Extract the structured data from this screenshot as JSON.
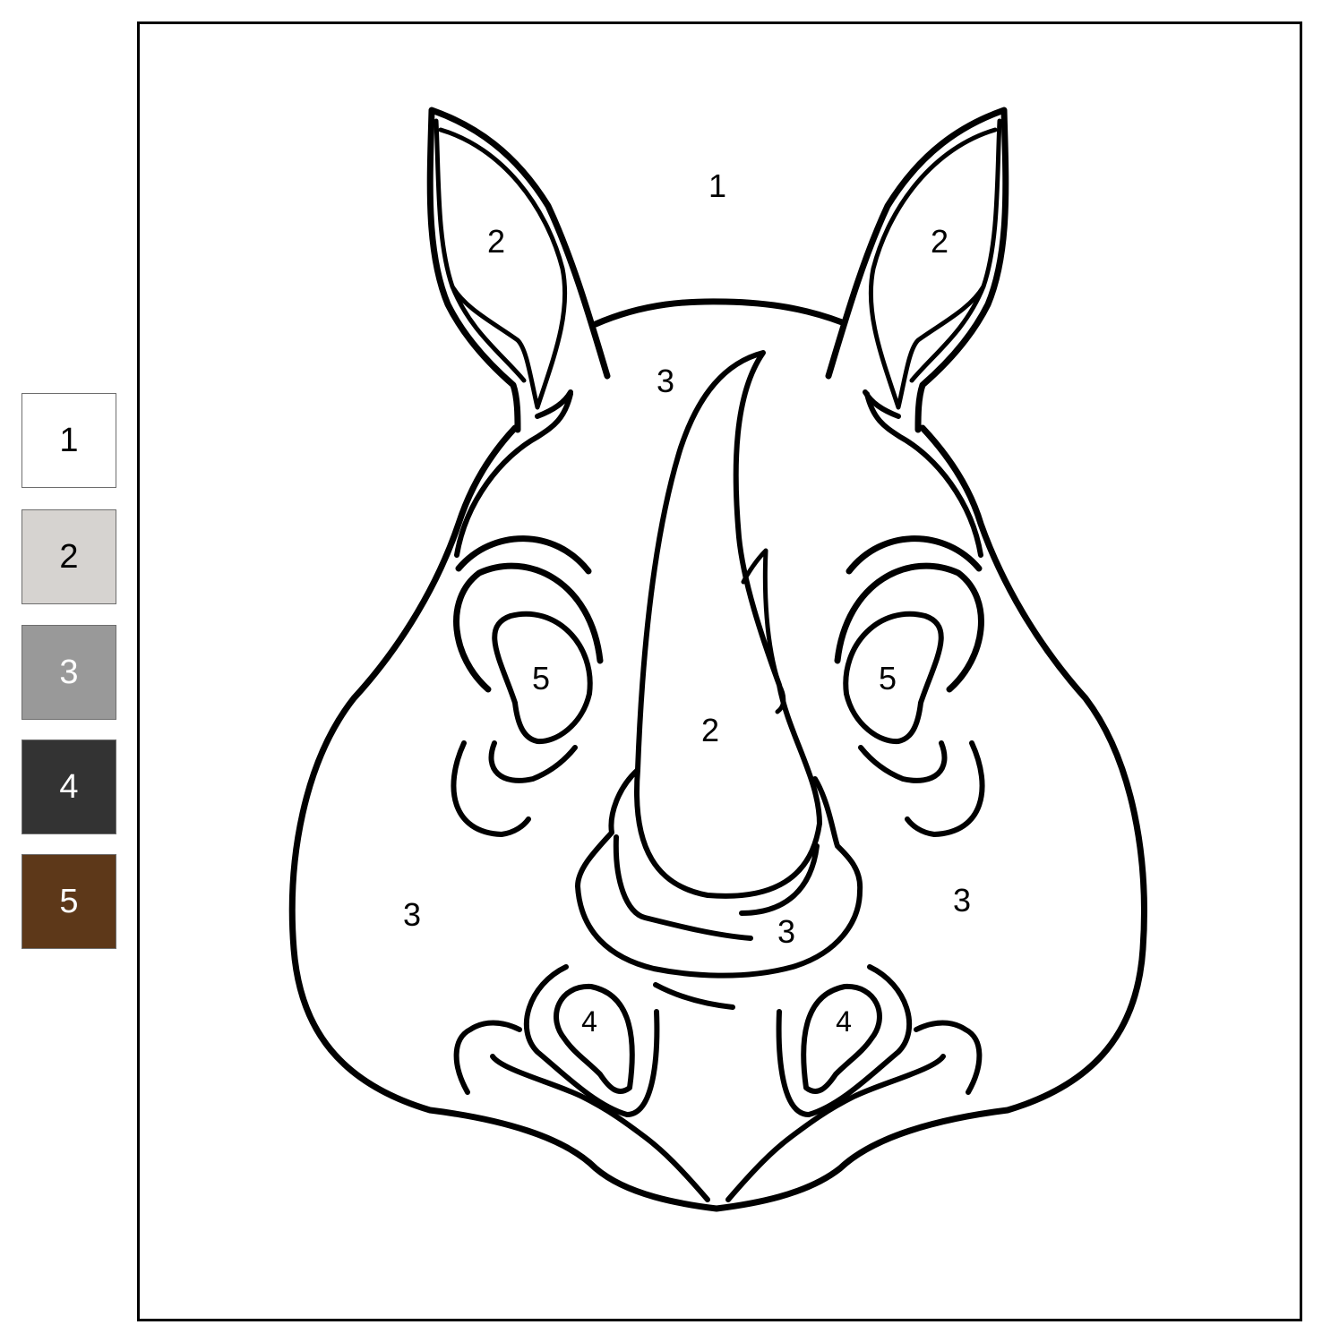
{
  "palette": [
    {
      "number": "1",
      "color": "#ffffff",
      "text_color": "#000000"
    },
    {
      "number": "2",
      "color": "#d6d3d0",
      "text_color": "#000000"
    },
    {
      "number": "3",
      "color": "#999999",
      "text_color": "#ffffff"
    },
    {
      "number": "4",
      "color": "#333333",
      "text_color": "#ffffff"
    },
    {
      "number": "5",
      "color": "#5d3819",
      "text_color": "#ffffff"
    }
  ],
  "region_labels": {
    "background": "1",
    "left_ear": "2",
    "right_ear": "2",
    "forehead": "3",
    "horn": "2",
    "left_eye": "5",
    "right_eye": "5",
    "left_cheek": "3",
    "right_cheek": "3",
    "snout": "3",
    "left_nostril": "4",
    "right_nostril": "4"
  }
}
